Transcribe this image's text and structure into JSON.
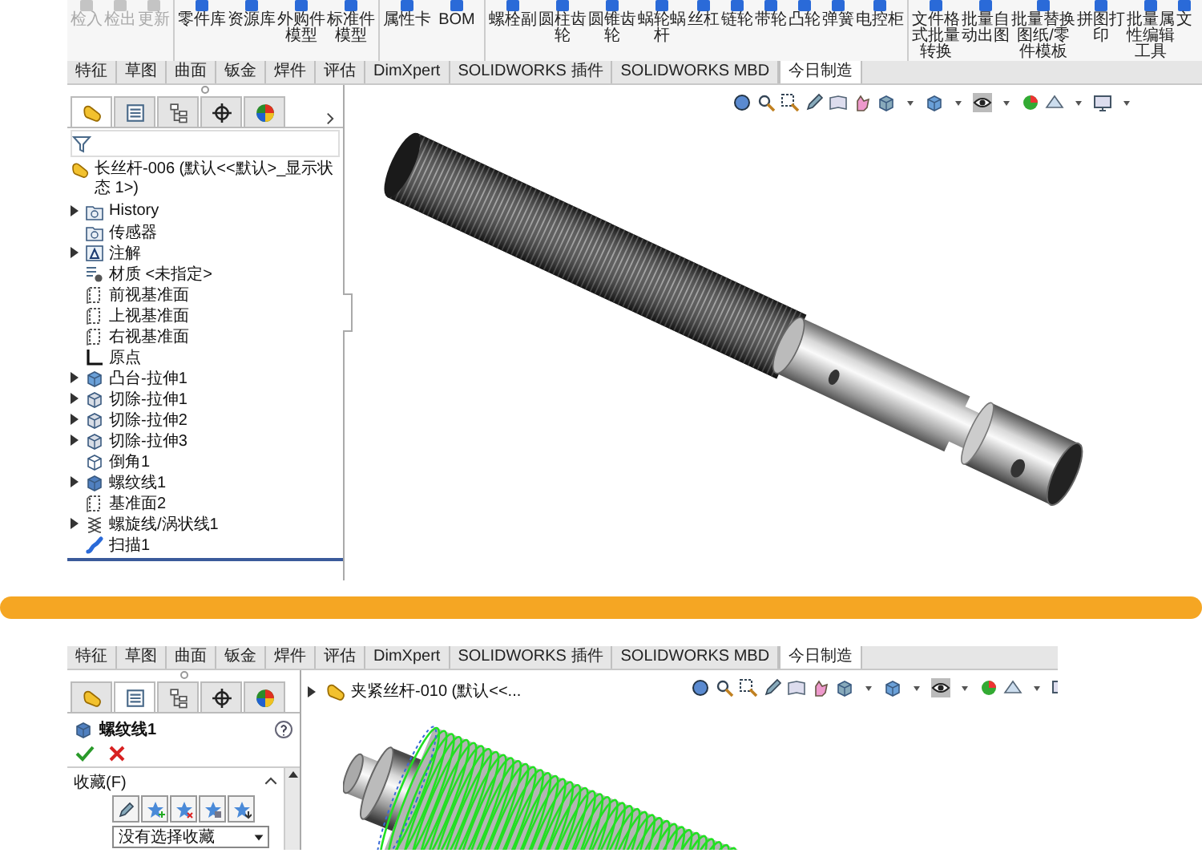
{
  "top_screen": {
    "toolbar": {
      "groups": [
        [
          {
            "label": "检入",
            "disabled": true
          },
          {
            "label": "检出",
            "disabled": true
          },
          {
            "label": "更新",
            "disabled": true
          }
        ],
        [
          {
            "label": "零件库",
            "disabled": false
          },
          {
            "label": "资源库",
            "disabled": false
          },
          {
            "label": "外购件模型",
            "disabled": false
          },
          {
            "label": "标准件模型",
            "disabled": false
          }
        ],
        [
          {
            "label": "属性卡",
            "disabled": false
          },
          {
            "label": "BOM",
            "disabled": false
          }
        ],
        [
          {
            "label": "螺栓副",
            "disabled": false
          },
          {
            "label": "圆柱齿轮",
            "disabled": false
          },
          {
            "label": "圆锥齿轮",
            "disabled": false
          },
          {
            "label": "蜗轮蜗杆",
            "disabled": false
          },
          {
            "label": "丝杠",
            "disabled": false
          },
          {
            "label": "链轮",
            "disabled": false
          },
          {
            "label": "带轮",
            "disabled": false
          },
          {
            "label": "凸轮",
            "disabled": false
          },
          {
            "label": "弹簧",
            "disabled": false
          },
          {
            "label": "电控柜",
            "disabled": false
          }
        ],
        [
          {
            "label": "文件格式批量转换",
            "disabled": false
          },
          {
            "label": "批量自动出图",
            "disabled": false
          },
          {
            "label": "批量替换图纸/零件模板",
            "disabled": false
          },
          {
            "label": "拼图打印",
            "disabled": false
          },
          {
            "label": "批量属性编辑工具",
            "disabled": false
          },
          {
            "label": "文",
            "disabled": false
          }
        ]
      ]
    },
    "command_tabs": [
      {
        "label": "特征",
        "selected": false
      },
      {
        "label": "草图",
        "selected": false
      },
      {
        "label": "曲面",
        "selected": false
      },
      {
        "label": "钣金",
        "selected": false
      },
      {
        "label": "焊件",
        "selected": false
      },
      {
        "label": "评估",
        "selected": false
      },
      {
        "label": "DimXpert",
        "selected": false
      },
      {
        "label": "SOLIDWORKS 插件",
        "selected": false
      },
      {
        "label": "SOLIDWORKS MBD",
        "selected": false
      },
      {
        "label": "今日制造",
        "selected": true
      }
    ],
    "panel_tabs": [
      {
        "kind": "feature_tree",
        "selected": true
      },
      {
        "kind": "property",
        "selected": false
      },
      {
        "kind": "configuration",
        "selected": false
      },
      {
        "kind": "dimxpert",
        "selected": false
      },
      {
        "kind": "display",
        "selected": false
      }
    ],
    "tree": {
      "root": "长丝杆-006 (默认<<默认>_显示状态 1>)",
      "items": [
        {
          "label": "History",
          "kind": "history",
          "collapsed": true
        },
        {
          "label": "传感器",
          "kind": "sensor",
          "collapsed": false
        },
        {
          "label": "注解",
          "kind": "annotation",
          "collapsed": true
        },
        {
          "label": "材质 <未指定>",
          "kind": "material",
          "collapsed": false
        },
        {
          "label": "前视基准面",
          "kind": "plane",
          "collapsed": false
        },
        {
          "label": "上视基准面",
          "kind": "plane",
          "collapsed": false
        },
        {
          "label": "右视基准面",
          "kind": "plane",
          "collapsed": false
        },
        {
          "label": "原点",
          "kind": "origin",
          "collapsed": false
        },
        {
          "label": "凸台-拉伸1",
          "kind": "boss",
          "collapsed": true
        },
        {
          "label": "切除-拉伸1",
          "kind": "cut",
          "collapsed": true
        },
        {
          "label": "切除-拉伸2",
          "kind": "cut",
          "collapsed": true
        },
        {
          "label": "切除-拉伸3",
          "kind": "cut",
          "collapsed": true
        },
        {
          "label": "倒角1",
          "kind": "chamfer",
          "collapsed": false
        },
        {
          "label": "螺纹线1",
          "kind": "thread",
          "collapsed": true
        },
        {
          "label": "基准面2",
          "kind": "plane",
          "collapsed": false
        },
        {
          "label": "螺旋线/涡状线1",
          "kind": "helix",
          "collapsed": true
        },
        {
          "label": "扫描1",
          "kind": "sweep",
          "collapsed": false
        }
      ]
    }
  },
  "bottom_screen": {
    "command_tabs": [
      {
        "label": "特征",
        "selected": false
      },
      {
        "label": "草图",
        "selected": false
      },
      {
        "label": "曲面",
        "selected": false
      },
      {
        "label": "钣金",
        "selected": false
      },
      {
        "label": "焊件",
        "selected": false
      },
      {
        "label": "评估",
        "selected": false
      },
      {
        "label": "DimXpert",
        "selected": false
      },
      {
        "label": "SOLIDWORKS 插件",
        "selected": false
      },
      {
        "label": "SOLIDWORKS MBD",
        "selected": false
      },
      {
        "label": "今日制造",
        "selected": true
      }
    ],
    "panel_tabs": [
      {
        "kind": "feature_tree",
        "selected": false
      },
      {
        "kind": "property",
        "selected": true
      },
      {
        "kind": "configuration",
        "selected": false
      },
      {
        "kind": "dimxpert",
        "selected": false
      },
      {
        "kind": "display",
        "selected": false
      }
    ],
    "property_manager": {
      "title": "螺纹线1",
      "favorites": {
        "label": "收藏(F)",
        "expanded": true,
        "dropdown": "没有选择收藏"
      }
    },
    "tree_header": {
      "label": "夹紧丝杆-010 (默认<<...",
      "collapsed": true
    }
  }
}
